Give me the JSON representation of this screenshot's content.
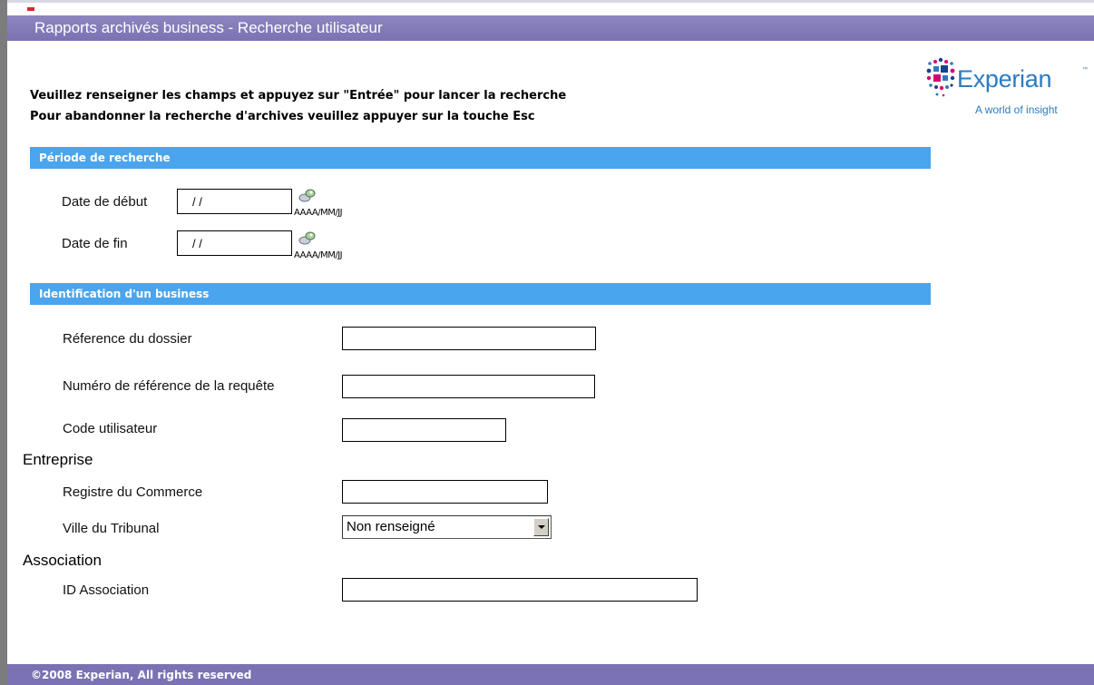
{
  "header": {
    "title": "Rapports archivés business - Recherche utilisateur"
  },
  "instructions": {
    "line1": "Veuillez renseigner les champs et appuyez sur \"Entrée\" pour lancer la recherche",
    "line2": "Pour abandonner la recherche d'archives veuillez appuyer sur la touche Esc"
  },
  "logo": {
    "word": "Experian",
    "tagline": "A world of insight",
    "tm": "™"
  },
  "period": {
    "title": "Période de recherche",
    "start_label": "Date de début",
    "start_value": "/ /",
    "end_label": "Date de fin",
    "end_value": "/ /",
    "date_format": "AAAA/MM/JJ",
    "calendar_icon": "calendar-picker-icon"
  },
  "business": {
    "title": "Identification d'un business",
    "dossier_label": "Réference du dossier",
    "dossier_value": "",
    "request_label": "Numéro de référence de la requête",
    "request_value": "",
    "user_label": "Code utilisateur",
    "user_value": ""
  },
  "entreprise": {
    "heading": "Entreprise",
    "registre_label": "Registre du Commerce",
    "registre_value": "",
    "ville_label": "Ville du Tribunal",
    "ville_selected": "Non renseigné"
  },
  "association": {
    "heading": "Association",
    "id_label": "ID Association",
    "id_value": ""
  },
  "footer": {
    "copyright": "©2008 Experian, All rights reserved"
  },
  "colors": {
    "titlebar": "#7a72b2",
    "section_bar": "#4aa5ee",
    "brand_blue": "#2c7bbf",
    "logo_dots": [
      "#2c7bbf",
      "#d6006f",
      "#1b3f91"
    ]
  }
}
